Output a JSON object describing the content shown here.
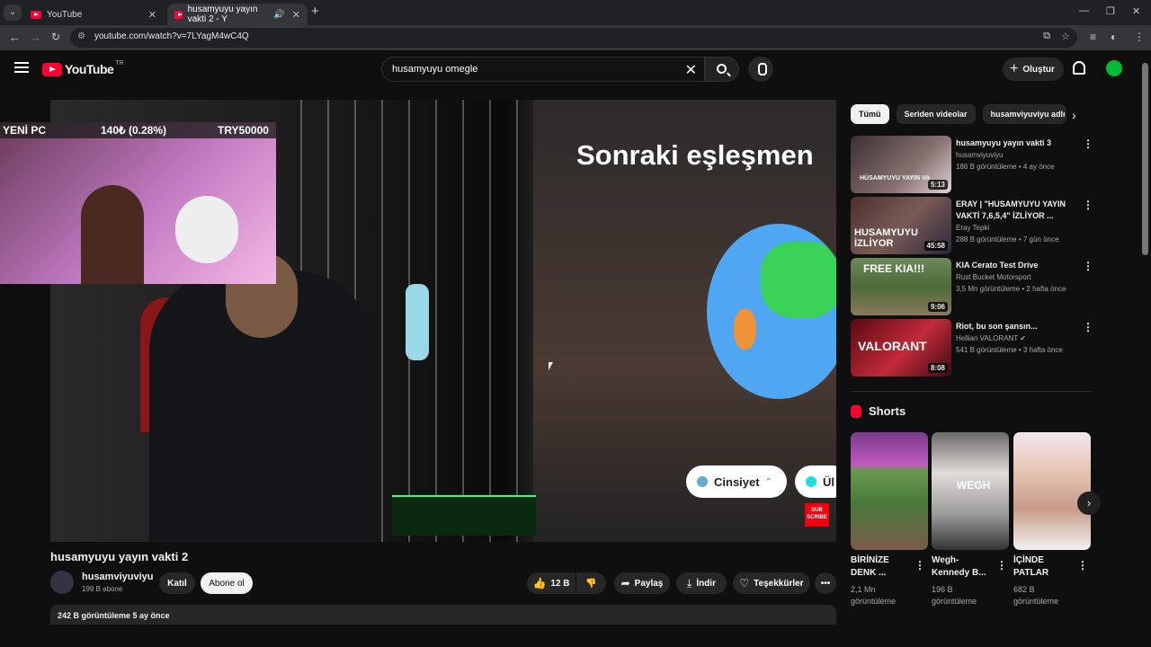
{
  "browser": {
    "tabs": [
      {
        "title": "YouTube"
      },
      {
        "title": "husamyuyu yayın vakti 2 - Y"
      }
    ],
    "url": "youtube.com/watch?v=7LYagM4wC4Q"
  },
  "header": {
    "logo_text": "YouTube",
    "country_code": "TR",
    "search_value": "husamyuyu omegle",
    "create_label": "Oluştur"
  },
  "player": {
    "overlay_left": "YENİ PC",
    "overlay_mid": "140₺ (0.28%)",
    "overlay_right": "TRY50000",
    "next_match_text": "Sonraki eşleşmen",
    "gender_pill": "Cinsiyet",
    "second_pill": "Ül",
    "sub_badge": "SUB SCRIBE"
  },
  "video": {
    "title": "husamyuyu yayın vakti 2",
    "channel": "husamviyuviyu",
    "subscribers": "199 B abone",
    "join_label": "Katıl",
    "subscribe_label": "Abone ol",
    "likes": "12 B",
    "share_label": "Paylaş",
    "download_label": "İndir",
    "thanks_label": "Teşekkürler",
    "views_date": "242 B görüntüleme  5 ay önce"
  },
  "chips": [
    "Tümü",
    "Seriden videolar",
    "husamviyuviyu adlı ya"
  ],
  "recommendations": [
    {
      "title": "husamyuyu yayın vakti 3",
      "channel": "husamviyuviyu",
      "meta": "186 B görüntüleme • 4 ay önce",
      "duration": "5:13",
      "thumb_text": "HÜSAMYUYU YAYIN VA"
    },
    {
      "title": "ERAY | \"HUSAMYUYU YAYIN VAKTİ 7,6,5,4\" İZLİYOR ...",
      "channel": "Eray Tepki",
      "meta": "288 B görüntüleme • 7 gün önce",
      "duration": "45:58",
      "thumb_text": "HUSAMYUYU İZLİYOR"
    },
    {
      "title": "KIA Cerato Test Drive",
      "channel": "Rust Bucket Motorsport",
      "meta": "3,5 Mn görüntüleme • 2 hafta önce",
      "duration": "9:06",
      "thumb_text": "FREE KIA!!!"
    },
    {
      "title": "Riot, bu son şansın...",
      "channel": "Hellian VALORANT",
      "meta": "541 B görüntüleme • 3 hafta önce",
      "duration": "8:08",
      "thumb_text": "VALORANT"
    }
  ],
  "shorts": {
    "heading": "Shorts",
    "items": [
      {
        "title": "BİRİNİZE DENK ...",
        "views": "2,1 Mn görüntüleme"
      },
      {
        "title": "Wegh-Kennedy B...",
        "views": "196 B görüntüleme",
        "thumb_text": "WEGH"
      },
      {
        "title": "İÇİNDE PATLAR",
        "views": "682 B görüntüleme"
      }
    ]
  },
  "colors": {
    "brand": "#ff0033",
    "background": "#0f0f0f"
  }
}
